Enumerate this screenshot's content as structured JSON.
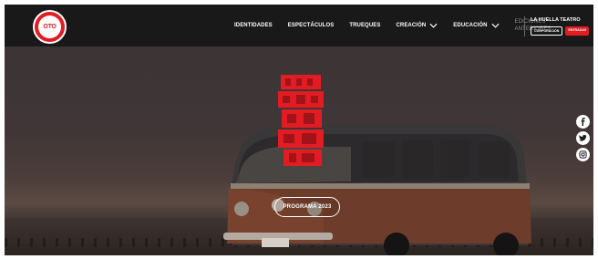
{
  "brand": {
    "logo_text": "OTO",
    "accent": "#e31c23"
  },
  "nav": {
    "items": [
      {
        "label": "IDENTIDADES",
        "dropdown": false
      },
      {
        "label": "ESPECTÁCULOS",
        "dropdown": false
      },
      {
        "label": "TRUEQUES",
        "dropdown": false
      },
      {
        "label": "CREACIÓN",
        "dropdown": true
      },
      {
        "label": "EDUCACIÓN",
        "dropdown": true
      }
    ],
    "editions_line1": "EDICIONES",
    "editions_line2": "ANTERIORES"
  },
  "huella": {
    "title": "LA HUELLA TEATRO",
    "button_outline": "CORPORACIÓN",
    "button_solid": "ENTRADAS"
  },
  "hero": {
    "program_button": "PROGRAMA 2023",
    "festival_logo_colors": [
      "#e31c23"
    ]
  },
  "social": [
    "facebook-icon",
    "twitter-icon",
    "instagram-icon"
  ]
}
